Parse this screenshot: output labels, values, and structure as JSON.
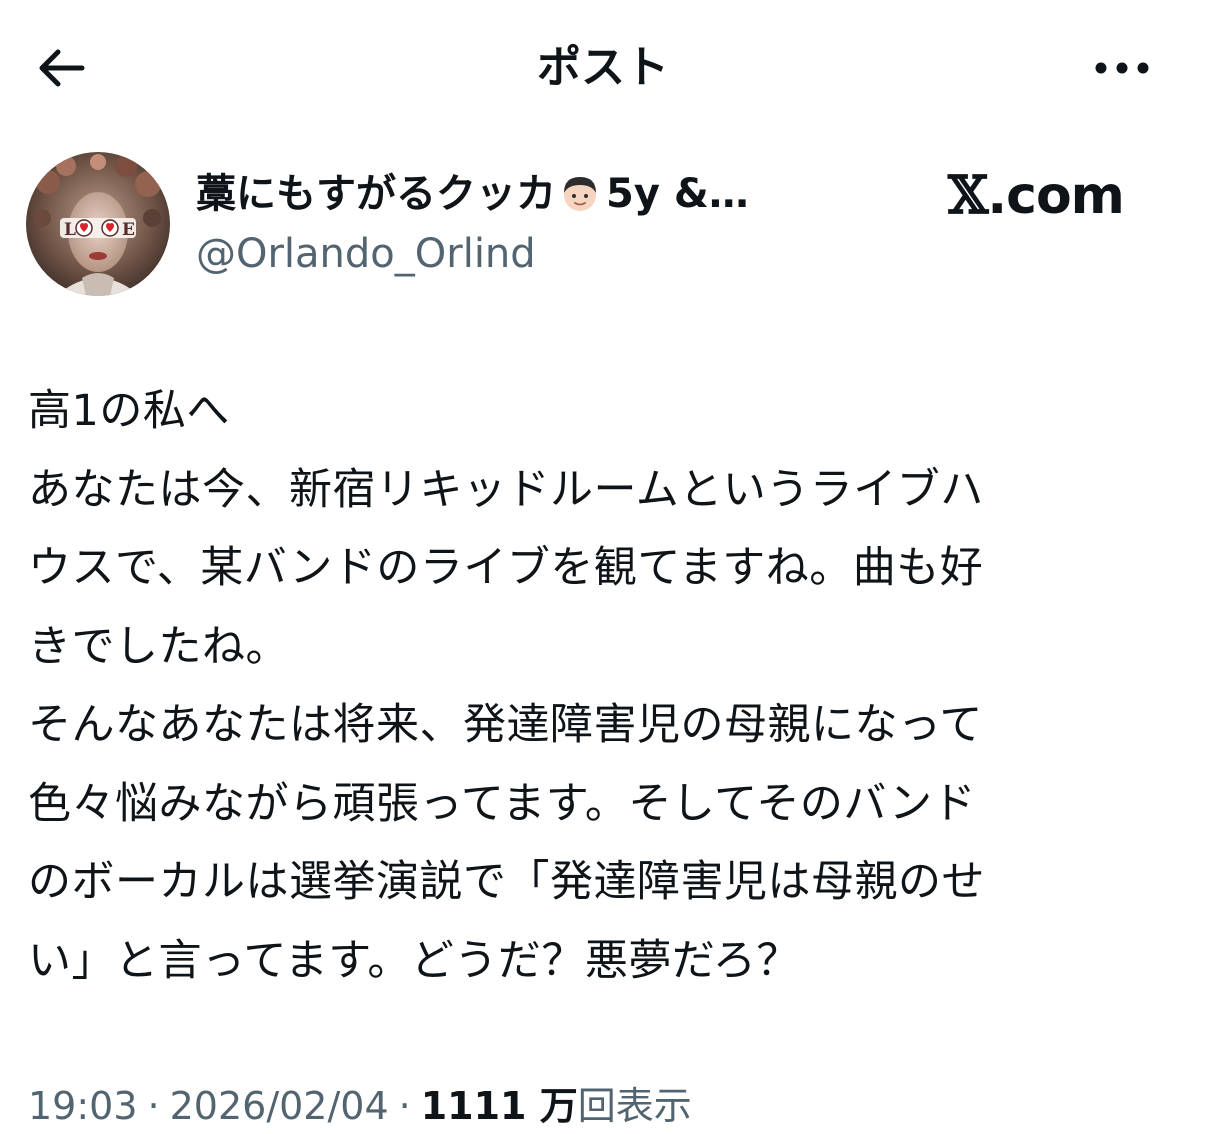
{
  "header": {
    "title": "ポスト",
    "back_icon": "back-arrow-icon",
    "more_icon": "more-dots-icon"
  },
  "author": {
    "display_name_prefix": "藁にもすがるクッカ",
    "display_name_emoji": "boy-face-emoji",
    "display_name_suffix": "5y &…",
    "handle": "@Orlando_Orlind",
    "avatar_text": "LOVE"
  },
  "watermark": {
    "x_glyph": "𝕏",
    "domain": ".com"
  },
  "post": {
    "lines": [
      "高1の私へ",
      "あなたは今、新宿リキッドルームというライブハ",
      "ウスで、某バンドのライブを観てますね。曲も好",
      "きでしたね。",
      "そんなあなたは将来、発達障害児の母親になって",
      "色々悩みながら頑張ってます。そしてそのバンド",
      "のボーカルは選挙演説で「発達障害児は母親のせ",
      "い」と言ってます。どうだ？悪夢だろ？"
    ]
  },
  "meta": {
    "time": "19:03",
    "separator": "·",
    "date": "2026/02/04",
    "views_count": "1111 万",
    "views_label": "回表示"
  },
  "colors": {
    "text": "#0f1419",
    "secondary": "#536471",
    "background": "#ffffff"
  }
}
